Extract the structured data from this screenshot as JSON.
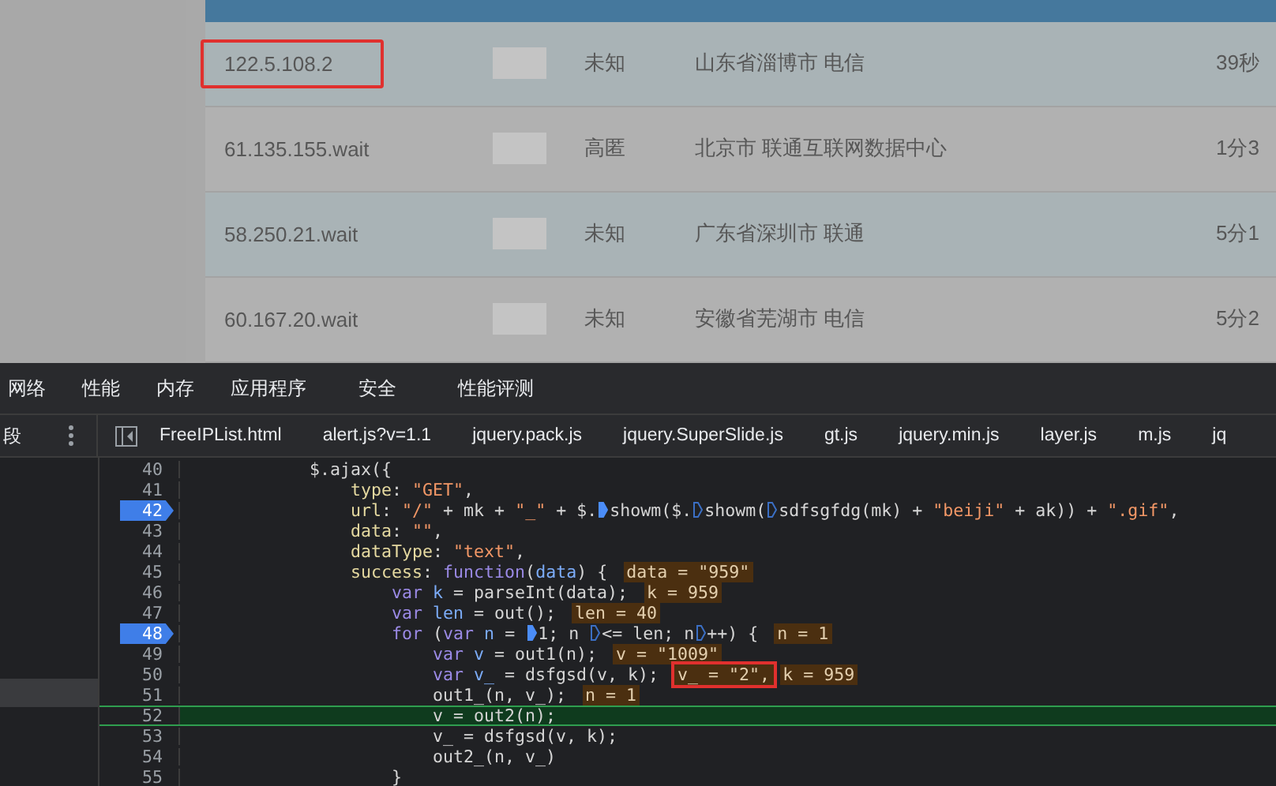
{
  "table": {
    "rows": [
      {
        "ip": "122.5.108.2",
        "anonymity": "未知",
        "location": "山东省淄博市 电信",
        "time": "39秒",
        "highlighted": true
      },
      {
        "ip": "61.135.155.wait",
        "anonymity": "高匿",
        "location": "北京市 联通互联网数据中心",
        "time": "1分3",
        "highlighted": false
      },
      {
        "ip": "58.250.21.wait",
        "anonymity": "未知",
        "location": "广东省深圳市 联通",
        "time": "5分1",
        "highlighted": false
      },
      {
        "ip": "60.167.20.wait",
        "anonymity": "未知",
        "location": "安徽省芜湖市 电信",
        "time": "5分2",
        "highlighted": false
      }
    ]
  },
  "devtools": {
    "menu": [
      "网络",
      "性能",
      "内存",
      "应用程序",
      "安全",
      "性能评测"
    ],
    "side_label": "段",
    "files": [
      "FreeIPList.html",
      "alert.js?v=1.1",
      "jquery.pack.js",
      "jquery.SuperSlide.js",
      "gt.js",
      "jquery.min.js",
      "layer.js",
      "m.js",
      "jq"
    ],
    "code": [
      {
        "number": "40",
        "breakpoint": false,
        "current": false,
        "tokens": [
          {
            "kind": "plain",
            "text": "            $.ajax({"
          }
        ]
      },
      {
        "number": "41",
        "breakpoint": false,
        "current": false,
        "tokens": [
          {
            "kind": "prop",
            "text": "                type"
          },
          {
            "kind": "plain",
            "text": ": "
          },
          {
            "kind": "string",
            "text": "\"GET\""
          },
          {
            "kind": "plain",
            "text": ","
          }
        ]
      },
      {
        "number": "42",
        "breakpoint": true,
        "current": false,
        "tokens": [
          {
            "kind": "prop",
            "text": "                url"
          },
          {
            "kind": "plain",
            "text": ": "
          },
          {
            "kind": "string",
            "text": "\"/\""
          },
          {
            "kind": "plain",
            "text": " + mk + "
          },
          {
            "kind": "string",
            "text": "\"_\""
          },
          {
            "kind": "plain",
            "text": " + $."
          },
          {
            "kind": "marker",
            "active": true
          },
          {
            "kind": "plain",
            "text": "showm($."
          },
          {
            "kind": "marker",
            "active": false
          },
          {
            "kind": "plain",
            "text": "showm("
          },
          {
            "kind": "marker",
            "active": false
          },
          {
            "kind": "plain",
            "text": "sdfsgfdg(mk) + "
          },
          {
            "kind": "string",
            "text": "\"beiji\""
          },
          {
            "kind": "plain",
            "text": " + ak)) + "
          },
          {
            "kind": "string",
            "text": "\".gif\""
          },
          {
            "kind": "plain",
            "text": ","
          }
        ]
      },
      {
        "number": "43",
        "breakpoint": false,
        "current": false,
        "tokens": [
          {
            "kind": "prop",
            "text": "                data"
          },
          {
            "kind": "plain",
            "text": ": "
          },
          {
            "kind": "string",
            "text": "\"\""
          },
          {
            "kind": "plain",
            "text": ","
          }
        ]
      },
      {
        "number": "44",
        "breakpoint": false,
        "current": false,
        "tokens": [
          {
            "kind": "prop",
            "text": "                dataType"
          },
          {
            "kind": "plain",
            "text": ": "
          },
          {
            "kind": "string",
            "text": "\"text\""
          },
          {
            "kind": "plain",
            "text": ","
          }
        ]
      },
      {
        "number": "45",
        "breakpoint": false,
        "current": false,
        "tokens": [
          {
            "kind": "prop",
            "text": "                success"
          },
          {
            "kind": "plain",
            "text": ": "
          },
          {
            "kind": "keyword",
            "text": "function"
          },
          {
            "kind": "plain",
            "text": "("
          },
          {
            "kind": "var",
            "text": "data"
          },
          {
            "kind": "plain",
            "text": ") {"
          },
          {
            "kind": "value",
            "text": "data = \"959\"",
            "boxed": false
          }
        ]
      },
      {
        "number": "46",
        "breakpoint": false,
        "current": false,
        "tokens": [
          {
            "kind": "keyword",
            "text": "                    var "
          },
          {
            "kind": "var",
            "text": "k"
          },
          {
            "kind": "plain",
            "text": " = parseInt(data);"
          },
          {
            "kind": "value",
            "text": "k = 959",
            "boxed": false
          }
        ]
      },
      {
        "number": "47",
        "breakpoint": false,
        "current": false,
        "tokens": [
          {
            "kind": "keyword",
            "text": "                    var "
          },
          {
            "kind": "var",
            "text": "len"
          },
          {
            "kind": "plain",
            "text": " = out();"
          },
          {
            "kind": "value",
            "text": "len = 40",
            "boxed": false
          }
        ]
      },
      {
        "number": "48",
        "breakpoint": true,
        "current": false,
        "tokens": [
          {
            "kind": "keyword",
            "text": "                    for"
          },
          {
            "kind": "plain",
            "text": " ("
          },
          {
            "kind": "keyword",
            "text": "var "
          },
          {
            "kind": "var",
            "text": "n"
          },
          {
            "kind": "plain",
            "text": " = "
          },
          {
            "kind": "marker",
            "active": true
          },
          {
            "kind": "plain",
            "text": "1; n "
          },
          {
            "kind": "marker",
            "active": false
          },
          {
            "kind": "plain",
            "text": "<= len; n"
          },
          {
            "kind": "marker",
            "active": false
          },
          {
            "kind": "plain",
            "text": "++) {"
          },
          {
            "kind": "value",
            "text": "n = 1",
            "boxed": false
          }
        ]
      },
      {
        "number": "49",
        "breakpoint": false,
        "current": false,
        "tokens": [
          {
            "kind": "keyword",
            "text": "                        var "
          },
          {
            "kind": "var",
            "text": "v"
          },
          {
            "kind": "plain",
            "text": " = out1(n);"
          },
          {
            "kind": "value",
            "text": "v = \"1009\"",
            "boxed": false
          }
        ]
      },
      {
        "number": "50",
        "breakpoint": false,
        "current": false,
        "tokens": [
          {
            "kind": "keyword",
            "text": "                        var "
          },
          {
            "kind": "var",
            "text": "v_"
          },
          {
            "kind": "plain",
            "text": " = dsfgsd(v, k);"
          },
          {
            "kind": "value",
            "text": "v_ = \"2\",",
            "boxed": true
          },
          {
            "kind": "value",
            "text": "k = 959",
            "boxed": false
          }
        ]
      },
      {
        "number": "51",
        "breakpoint": false,
        "current": false,
        "tokens": [
          {
            "kind": "plain",
            "text": "                        out1_(n, v_);"
          },
          {
            "kind": "value",
            "text": "n = 1",
            "boxed": false
          }
        ]
      },
      {
        "number": "52",
        "breakpoint": false,
        "current": true,
        "tokens": [
          {
            "kind": "plain",
            "text": "                        v = out2(n);"
          }
        ]
      },
      {
        "number": "53",
        "breakpoint": false,
        "current": false,
        "tokens": [
          {
            "kind": "plain",
            "text": "                        v_ = dsfgsd(v, k);"
          }
        ]
      },
      {
        "number": "54",
        "breakpoint": false,
        "current": false,
        "tokens": [
          {
            "kind": "plain",
            "text": "                        out2_(n, v_)"
          }
        ]
      },
      {
        "number": "55",
        "breakpoint": false,
        "current": false,
        "tokens": [
          {
            "kind": "plain",
            "text": "                    }"
          }
        ]
      }
    ]
  }
}
